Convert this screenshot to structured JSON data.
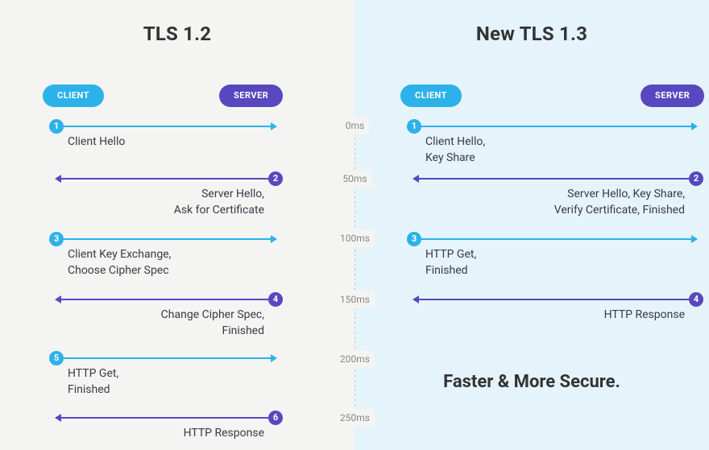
{
  "left": {
    "title": "TLS 1.2",
    "clientLabel": "CLIENT",
    "serverLabel": "SERVER",
    "steps": [
      {
        "num": "1",
        "dir": "client",
        "label": "Client Hello"
      },
      {
        "num": "2",
        "dir": "server",
        "label": "Server Hello,\nAsk for Certificate"
      },
      {
        "num": "3",
        "dir": "client",
        "label": "Client Key Exchange,\nChoose Cipher Spec"
      },
      {
        "num": "4",
        "dir": "server",
        "label": "Change Cipher Spec,\nFinished"
      },
      {
        "num": "5",
        "dir": "client",
        "label": "HTTP Get,\nFinished"
      },
      {
        "num": "6",
        "dir": "server",
        "label": "HTTP Response"
      }
    ]
  },
  "right": {
    "title": "New TLS 1.3",
    "clientLabel": "CLIENT",
    "serverLabel": "SERVER",
    "steps": [
      {
        "num": "1",
        "dir": "client",
        "label": "Client Hello,\nKey Share"
      },
      {
        "num": "2",
        "dir": "server",
        "label": "Server Hello, Key Share,\nVerify Certificate, Finished"
      },
      {
        "num": "3",
        "dir": "client",
        "label": "HTTP Get,\nFinished"
      },
      {
        "num": "4",
        "dir": "server",
        "label": "HTTP Response"
      }
    ],
    "tagline": "Faster & More Secure."
  },
  "axis": {
    "ticks": [
      "0ms",
      "50ms",
      "100ms",
      "150ms",
      "200ms",
      "250ms"
    ]
  }
}
